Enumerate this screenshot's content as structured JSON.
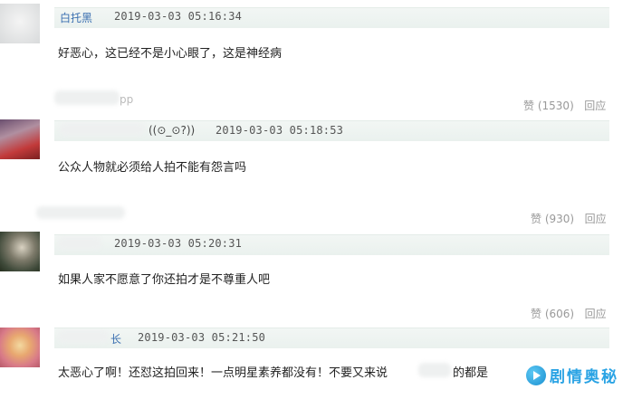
{
  "comments": [
    {
      "username": "白托黑",
      "timestamp": "2019-03-03 05:16:34",
      "text": "好恶心，这已经不是小心眼了，这是神经病",
      "like_label": "赞",
      "like_count": "(1530)",
      "reply_label": "回应",
      "reply_preview_name": "pp"
    },
    {
      "username": "((⊙_⊙?))",
      "timestamp": "2019-03-03 05:18:53",
      "text": "公众人物就必须给人拍不能有怨言吗",
      "like_label": "赞",
      "like_count": "(930)",
      "reply_label": "回应"
    },
    {
      "username": "",
      "timestamp": "2019-03-03 05:20:31",
      "text": "如果人家不愿意了你还拍才是不尊重人吧",
      "like_label": "赞",
      "like_count": "(606)",
      "reply_label": "回应"
    },
    {
      "username": "长",
      "timestamp": "2019-03-03 05:21:50",
      "text": "太恶心了啊！还怼这拍回来！一点明星素养都没有！不要又来说",
      "text_tail": "的都是"
    }
  ],
  "watermark": {
    "icon": "play-icon",
    "text": "剧情奥秘"
  }
}
